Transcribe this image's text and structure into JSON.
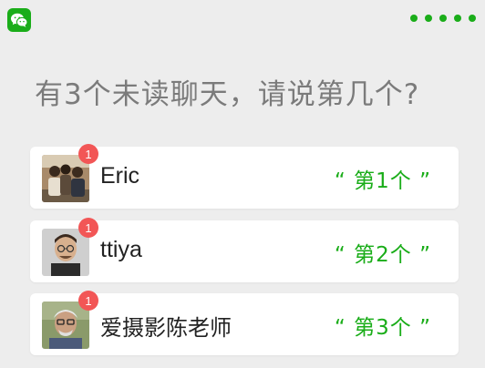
{
  "app": {
    "icon": "wechat-icon",
    "menu_icon": "more-dots-icon"
  },
  "prompt": "有3个未读聊天，请说第几个?",
  "chats": [
    {
      "name": "Eric",
      "unread": "1",
      "hint": "“ 第1个 ”",
      "avatar": "group-photo-avatar"
    },
    {
      "name": "ttiya",
      "unread": "1",
      "hint": "“ 第2个 ”",
      "avatar": "man-portrait-avatar"
    },
    {
      "name": "爱摄影陈老师",
      "unread": "1",
      "hint": "“ 第3个 ”",
      "avatar": "elderly-man-avatar"
    }
  ],
  "colors": {
    "accent": "#1aad19",
    "badge": "#f25656",
    "background": "#ededed"
  }
}
